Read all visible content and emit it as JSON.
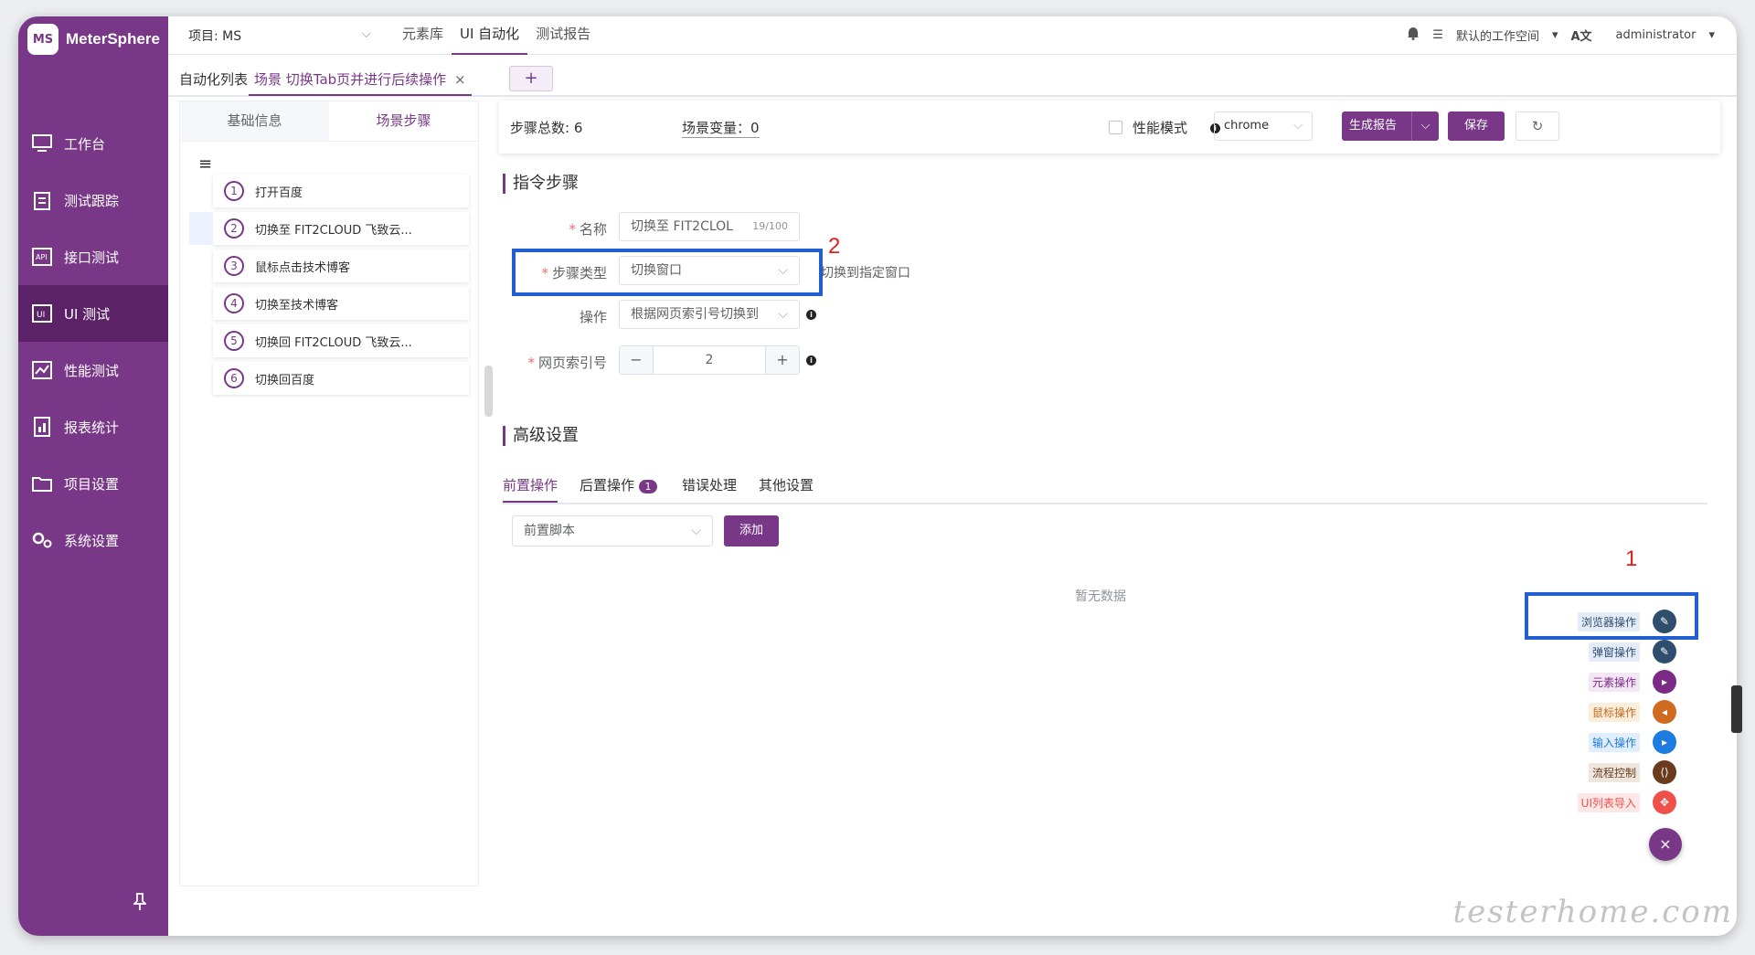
{
  "app": {
    "name": "MeterSphere",
    "logo_text": "MS"
  },
  "sidebar": {
    "items": [
      {
        "label": "工作台",
        "icon": "monitor-icon"
      },
      {
        "label": "测试跟踪",
        "icon": "clipboard-icon"
      },
      {
        "label": "接口测试",
        "icon": "api-icon"
      },
      {
        "label": "UI 测试",
        "icon": "ui-icon"
      },
      {
        "label": "性能测试",
        "icon": "chart-icon"
      },
      {
        "label": "报表统计",
        "icon": "report-icon"
      },
      {
        "label": "项目设置",
        "icon": "folder-icon"
      },
      {
        "label": "系统设置",
        "icon": "gear-icon"
      }
    ],
    "active_index": 3
  },
  "header": {
    "project_label": "项目: MS",
    "menu": [
      "元素库",
      "UI 自动化",
      "测试报告"
    ],
    "active_menu": 1,
    "workspace": "默认的工作空间",
    "user": "administrator",
    "lang": "A文"
  },
  "scenario_tabs": {
    "list_label": "自动化列表",
    "open_tab": "场景 切换Tab页并进行后续操作",
    "close": "×",
    "add": "+"
  },
  "step_panel": {
    "tabs": [
      "基础信息",
      "场景步骤"
    ],
    "active_tab": 1,
    "steps": [
      {
        "num": "1",
        "label": "打开百度"
      },
      {
        "num": "2",
        "label": "切换至 FIT2CLOUD 飞致云..."
      },
      {
        "num": "3",
        "label": "鼠标点击技术博客"
      },
      {
        "num": "4",
        "label": "切换至技术博客"
      },
      {
        "num": "5",
        "label": "切换回 FIT2CLOUD 飞致云..."
      },
      {
        "num": "6",
        "label": "切换回百度"
      }
    ],
    "selected_index": 1
  },
  "summary": {
    "step_total": "步骤总数:  6",
    "scene_var": "场景变量：0",
    "perf_mode": "性能模式",
    "browser": "chrome",
    "generate_report": "生成报告",
    "save": "保存",
    "refresh_icon": "↻"
  },
  "command": {
    "section_title": "指令步骤",
    "name_label": "名称",
    "name_value": "切换至 FIT2CLOL",
    "name_count": "19/100",
    "type_label": "步骤类型",
    "type_value": "切换窗口",
    "type_hint": "切换到指定窗口",
    "op_label": "操作",
    "op_value": "根据网页索引号切换到",
    "index_label": "网页索引号",
    "index_value": "2",
    "minus": "−",
    "plus": "+"
  },
  "advanced": {
    "section_title": "高级设置",
    "tabs": [
      "前置操作",
      "后置操作",
      "错误处理",
      "其他设置"
    ],
    "post_badge": "1",
    "script_select": "前置脚本",
    "add_button": "添加",
    "empty": "暂无数据"
  },
  "fab_menu": [
    {
      "label": "浏览器操作",
      "color": "#2f4e6e",
      "bg": "#e4ecf7",
      "text_color": "#2f4e6e",
      "glyph": "✎"
    },
    {
      "label": "弹窗操作",
      "color": "#2f4e6e",
      "bg": "#e4ecf7",
      "text_color": "#2f4e6e",
      "glyph": "✎"
    },
    {
      "label": "元素操作",
      "color": "#7b2a86",
      "bg": "#f3e6f5",
      "text_color": "#7b2a86",
      "glyph": "▸"
    },
    {
      "label": "鼠标操作",
      "color": "#d06a1e",
      "bg": "#fbeedd",
      "text_color": "#c06a1e",
      "glyph": "◂"
    },
    {
      "label": "输入操作",
      "color": "#1e7be0",
      "bg": "#e1eefc",
      "text_color": "#1e7be0",
      "glyph": "▸"
    },
    {
      "label": "流程控制",
      "color": "#6b3b1e",
      "bg": "#efe6de",
      "text_color": "#6b3b1e",
      "glyph": "⟨⟩"
    },
    {
      "label": "UI列表导入",
      "color": "#f0504a",
      "bg": "#fde8e7",
      "text_color": "#f0504a",
      "glyph": "✥"
    }
  ],
  "fab_close": "×",
  "annotations": {
    "marker1": "1",
    "marker2": "2"
  },
  "watermark": "testerhome.com"
}
